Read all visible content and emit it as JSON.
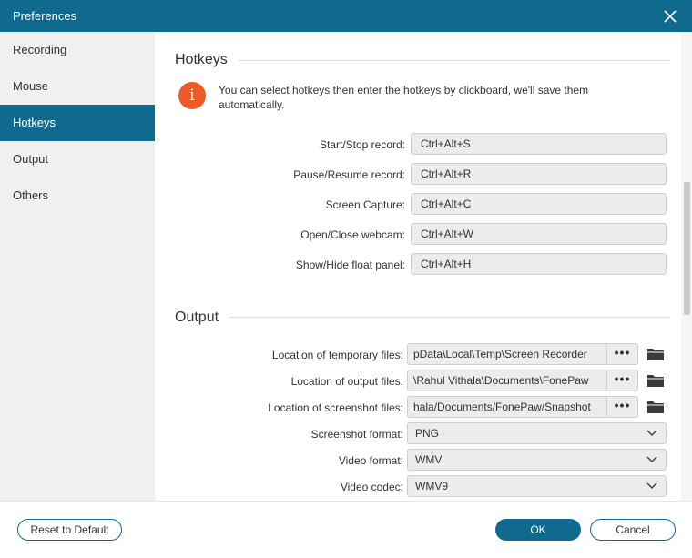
{
  "window": {
    "title": "Preferences"
  },
  "sidebar": {
    "items": [
      {
        "label": "Recording"
      },
      {
        "label": "Mouse"
      },
      {
        "label": "Hotkeys"
      },
      {
        "label": "Output"
      },
      {
        "label": "Others"
      }
    ],
    "active_label": "Hotkeys"
  },
  "hotkeys": {
    "title": "Hotkeys",
    "info": "You can select hotkeys then enter the hotkeys by clickboard, we'll save them automatically.",
    "rows": [
      {
        "label": "Start/Stop record:",
        "value": "Ctrl+Alt+S"
      },
      {
        "label": "Pause/Resume record:",
        "value": "Ctrl+Alt+R"
      },
      {
        "label": "Screen Capture:",
        "value": "Ctrl+Alt+C"
      },
      {
        "label": "Open/Close webcam:",
        "value": "Ctrl+Alt+W"
      },
      {
        "label": "Show/Hide float panel:",
        "value": "Ctrl+Alt+H"
      }
    ]
  },
  "output": {
    "title": "Output",
    "paths": [
      {
        "label": "Location of temporary files:",
        "value": "pData\\Local\\Temp\\Screen Recorder",
        "button": "•••"
      },
      {
        "label": "Location of output files:",
        "value": "\\Rahul Vithala\\Documents\\FonePaw",
        "button": "•••"
      },
      {
        "label": "Location of screenshot files:",
        "value": "hala/Documents/FonePaw/Snapshot",
        "button": "•••"
      }
    ],
    "selects": [
      {
        "label": "Screenshot format:",
        "value": "PNG"
      },
      {
        "label": "Video format:",
        "value": "WMV"
      },
      {
        "label": "Video codec:",
        "value": "WMV9"
      }
    ]
  },
  "footer": {
    "reset_label": "Reset to Default",
    "ok_label": "OK",
    "cancel_label": "Cancel"
  },
  "colors": {
    "accent": "#0f6a8e",
    "info_icon": "#f05a28"
  }
}
